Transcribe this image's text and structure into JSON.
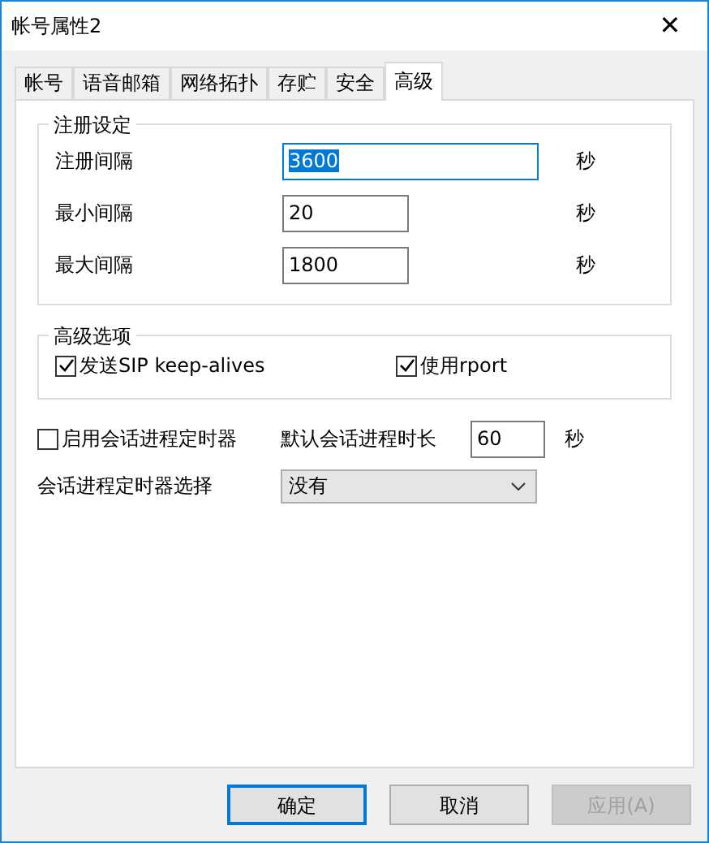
{
  "window": {
    "title": "帐号属性2",
    "close": "✕"
  },
  "tabs": [
    {
      "label": "帐号",
      "selected": false
    },
    {
      "label": "语音邮箱",
      "selected": false
    },
    {
      "label": "网络拓扑",
      "selected": false
    },
    {
      "label": "存贮",
      "selected": false
    },
    {
      "label": "安全",
      "selected": false
    },
    {
      "label": "高级",
      "selected": true
    }
  ],
  "registration": {
    "title": "注册设定",
    "rows": [
      {
        "label": "注册间隔",
        "value": "3600",
        "unit": "秒",
        "wide": true,
        "focused": true
      },
      {
        "label": "最小间隔",
        "value": "20",
        "unit": "秒",
        "wide": false,
        "focused": false
      },
      {
        "label": "最大间隔",
        "value": "1800",
        "unit": "秒",
        "wide": false,
        "focused": false
      }
    ]
  },
  "advanced": {
    "title": "高级选项",
    "options": [
      {
        "label": "发送SIP keep-alives",
        "checked": true
      },
      {
        "label": "使用rport",
        "checked": true
      }
    ]
  },
  "session_timer": {
    "label": "启用会话进程定时器",
    "checked": false,
    "duration_label": "默认会话进程时长",
    "duration": "60",
    "unit": "秒"
  },
  "timer_select": {
    "label": "会话进程定时器选择",
    "value": "没有"
  },
  "buttons": [
    {
      "label": "确定",
      "default": true,
      "disabled": false
    },
    {
      "label": "取消",
      "default": false,
      "disabled": false
    },
    {
      "label": "应用(A)",
      "default": false,
      "disabled": true
    }
  ]
}
